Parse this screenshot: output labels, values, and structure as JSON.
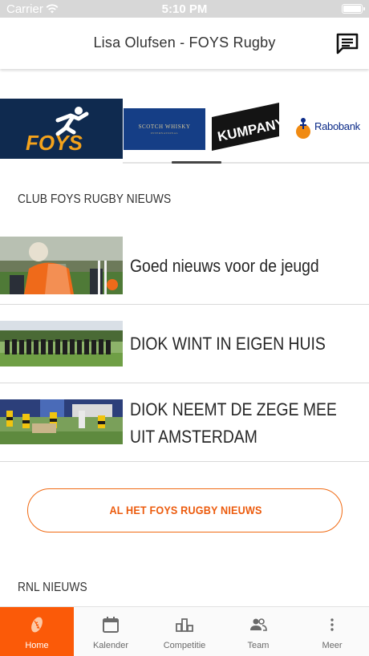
{
  "status_bar": {
    "carrier": "Carrier",
    "time": "5:10 PM",
    "icons": [
      "wifi-icon",
      "battery-icon"
    ]
  },
  "header": {
    "title": "Lisa Olufsen - FOYS Rugby",
    "chat_icon": "chat-icon"
  },
  "sponsors": {
    "items": [
      {
        "name": "foys-logo",
        "text": "FOYS"
      },
      {
        "name": "scotch-whisky-logo",
        "text": "SCOTCH WHISKY",
        "subtext": "INTERNATIONAL"
      },
      {
        "name": "kumpany-logo",
        "text": "KUMPANY"
      },
      {
        "name": "rabobank-logo",
        "text": "Rabobank"
      }
    ]
  },
  "club_news": {
    "section_title": "CLUB FOYS RUGBY NIEUWS",
    "items": [
      {
        "title": "Goed nieuws voor de jeugd"
      },
      {
        "title": "DIOK WINT IN EIGEN HUIS"
      },
      {
        "title": "DIOK NEEMT DE ZEGE MEE UIT AMSTERDAM"
      }
    ],
    "all_news_label": "AL HET FOYS RUGBY NIEUWS"
  },
  "rnl_news": {
    "section_title": "RNL NIEUWS"
  },
  "tabbar": {
    "tabs": [
      {
        "label": "Home",
        "icon": "rugby-ball-icon",
        "active": true
      },
      {
        "label": "Kalender",
        "icon": "calendar-icon",
        "active": false
      },
      {
        "label": "Competitie",
        "icon": "podium-icon",
        "active": false
      },
      {
        "label": "Team",
        "icon": "team-icon",
        "active": false
      },
      {
        "label": "Meer",
        "icon": "more-icon",
        "active": false
      }
    ]
  },
  "colors": {
    "accent": "#fb5a08",
    "foys_navy": "#0f2a4f",
    "rabobank_blue": "#0a2a88",
    "scotch_blue": "#153e86"
  }
}
